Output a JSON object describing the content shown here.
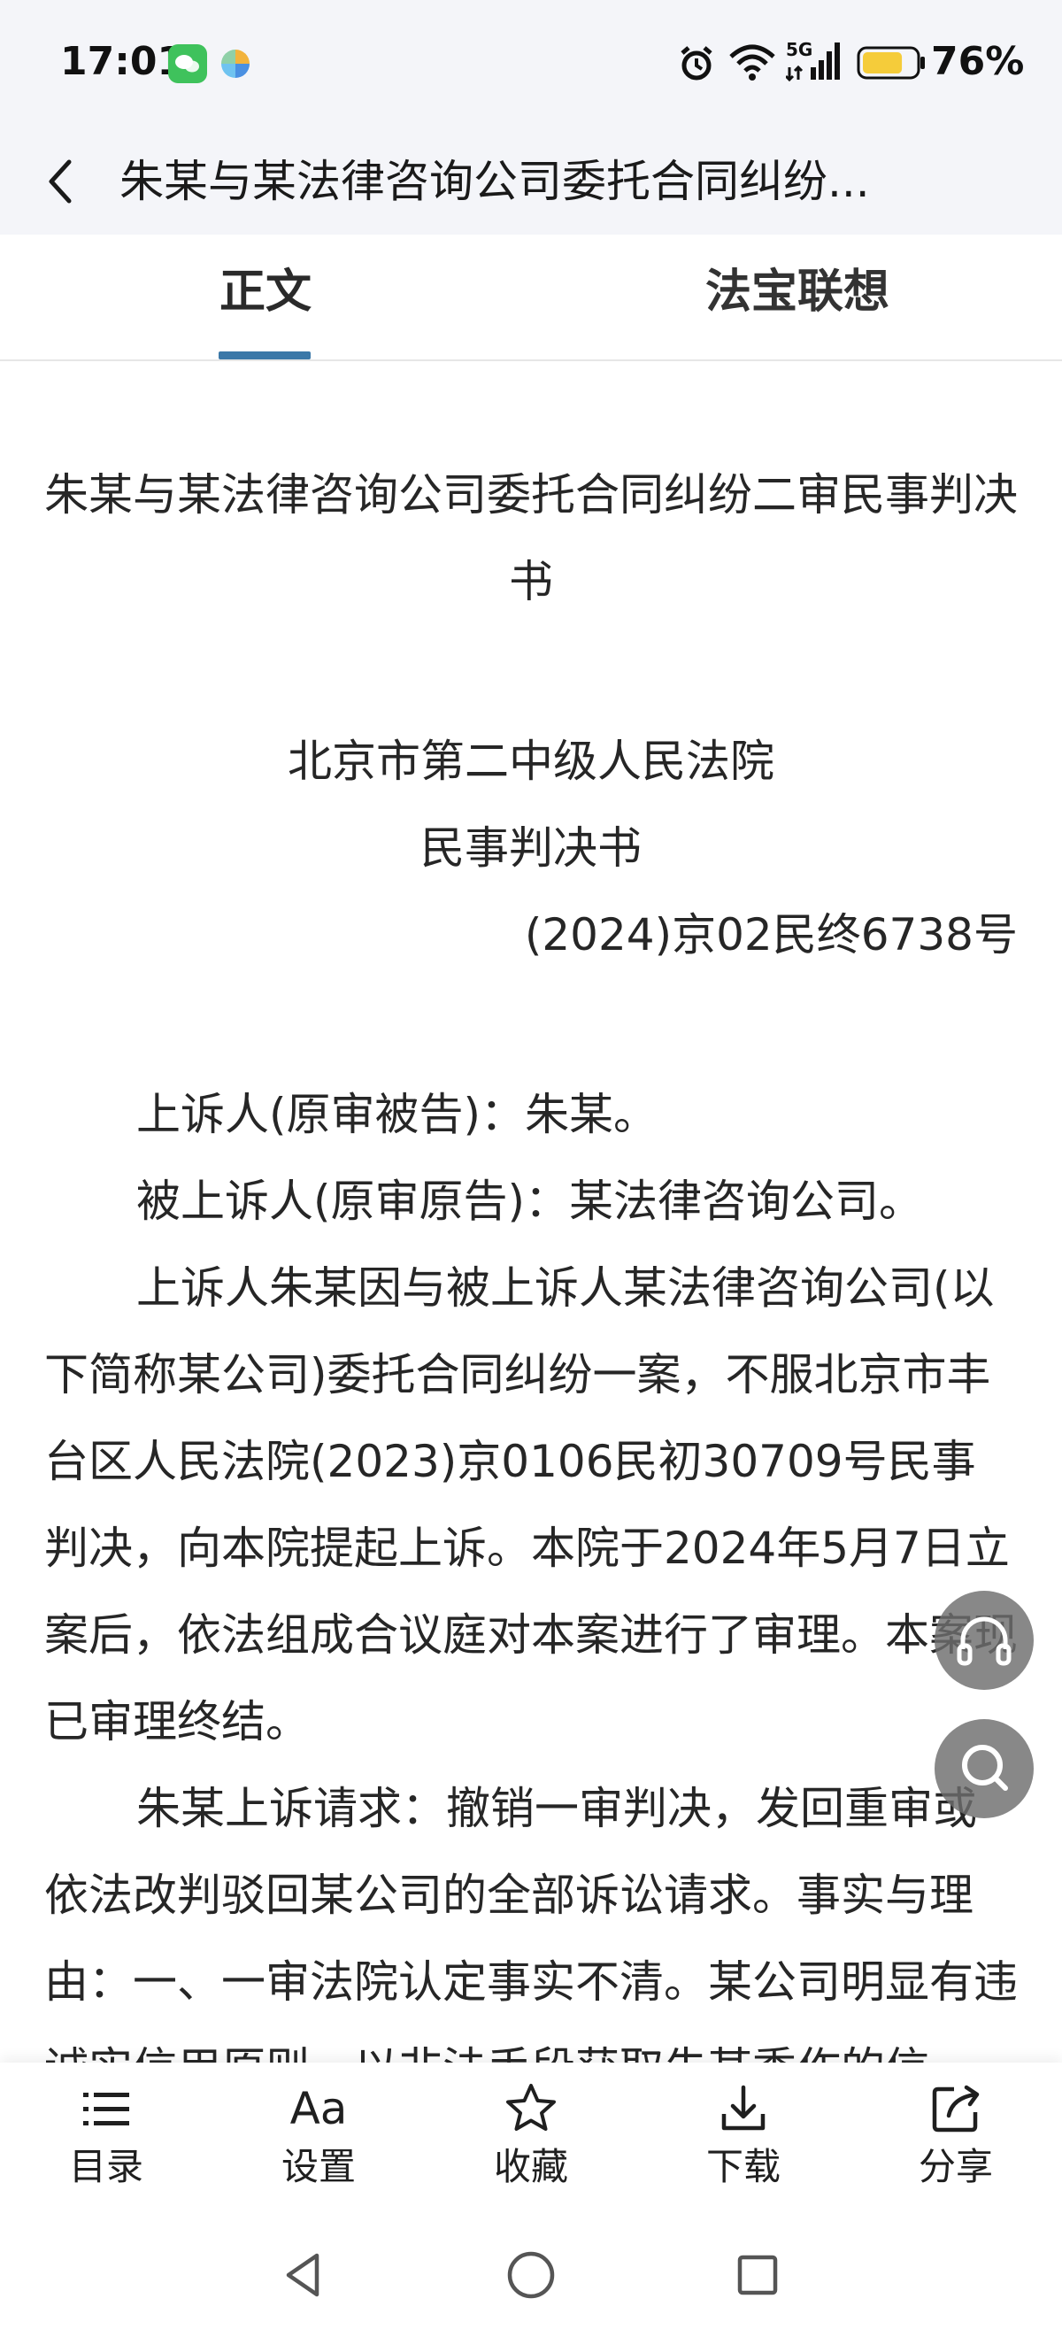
{
  "status_bar": {
    "time": "17:01",
    "network": "5G",
    "battery_percent": "76%",
    "battery_level": 0.76
  },
  "header": {
    "title": "朱某与某法律咨询公司委托合同纠纷..."
  },
  "tabs": [
    {
      "label": "正文",
      "active": true
    },
    {
      "label": "法宝联想",
      "active": false
    }
  ],
  "document": {
    "title": "朱某与某法律咨询公司委托合同纠纷二审民事判决书",
    "court": "北京市第二中级人民法院",
    "doc_kind": "民事判决书",
    "case_number": "(2024)京02民终6738号",
    "paragraphs": [
      "上诉人(原审被告)：朱某。",
      "被上诉人(原审原告)：某法律咨询公司。",
      "上诉人朱某因与被上诉人某法律咨询公司(以下简称某公司)委托合同纠纷一案，不服北京市丰台区人民法院(2023)京0106民初30709号民事判决，向本院提起上诉。本院于2024年5月7日立案后，依法组成合议庭对本案进行了审理。本案现已审理终结。",
      "朱某上诉请求：撤销一审判决，发回重审或依法改判驳回某公司的全部诉讼请求。事实与理由：一、一审法院认定事实不清。某公司明显有违诚实信用原则，以非法手段获取朱某委作的信"
    ]
  },
  "fabs": {
    "listen_icon": "headphones-icon",
    "search_icon": "search-icon"
  },
  "toolbar": {
    "toc_label": "目录",
    "settings_icon_text": "Aa",
    "settings_label": "设置",
    "favorite_label": "收藏",
    "download_label": "下载",
    "share_label": "分享"
  },
  "colors": {
    "accent": "#3b78a8",
    "header_bg": "#f4f5f9",
    "wechat": "#3fc25c",
    "battery": "#f5cc3a"
  }
}
